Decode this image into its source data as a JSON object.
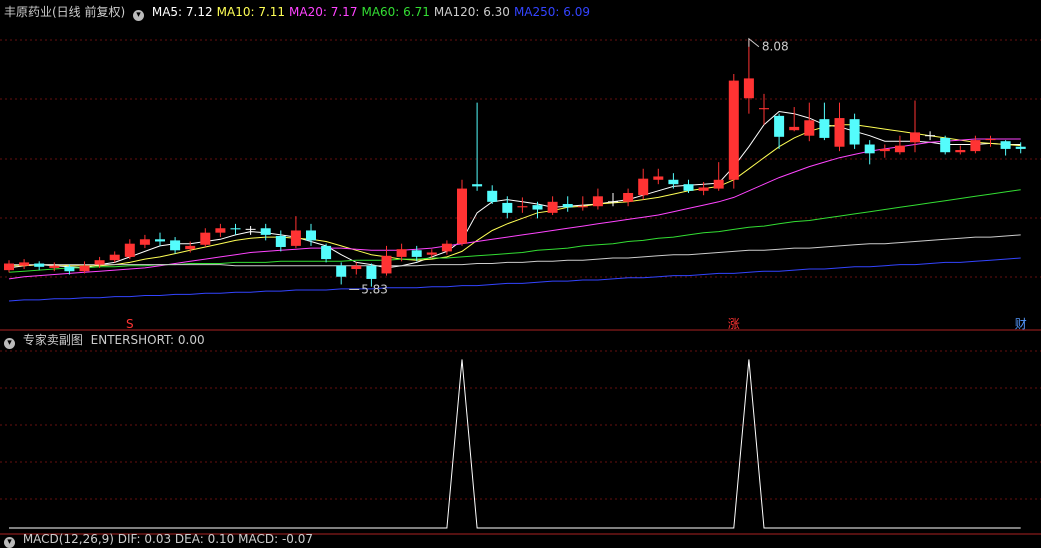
{
  "header": {
    "title": "丰原药业(日线 前复权)",
    "ma": [
      {
        "label": "MA5: 7.12",
        "color": "#ffffff"
      },
      {
        "label": "MA10: 7.11",
        "color": "#ffff55"
      },
      {
        "label": "MA20: 7.17",
        "color": "#ff44ff"
      },
      {
        "label": "MA60: 6.71",
        "color": "#33dd33"
      },
      {
        "label": "MA120: 6.30",
        "color": "#cccccc"
      },
      {
        "label": "MA250: 6.09",
        "color": "#3344ff"
      }
    ]
  },
  "sub_header": {
    "title": "专家卖副图",
    "value": "ENTERSHORT: 0.00"
  },
  "bottom_header": {
    "text": "MACD(12,26,9) DIF: 0.03 DEA: 0.10 MACD: -0.07"
  },
  "markers": [
    {
      "label": "S",
      "index": 8,
      "color": "#ff3333"
    },
    {
      "label": "涨",
      "index": 48,
      "color": "#ff3333"
    },
    {
      "label": "财",
      "index": 67,
      "color": "#5599ff"
    }
  ],
  "colors": {
    "up": "#ff3333",
    "down": "#54fcfc",
    "grid": "#661111",
    "axis": "#aa2222",
    "line": "#ffffff"
  },
  "chart_data": [
    {
      "type": "candlestick",
      "ylim": [
        5.6,
        8.25
      ],
      "max_label": "8.08",
      "min_label": "5.83",
      "max_index": 49,
      "min_index": 22,
      "candles": [
        [
          5.98,
          6.04,
          6.07,
          5.96
        ],
        [
          6.02,
          6.05,
          6.08,
          5.99
        ],
        [
          6.04,
          6.01,
          6.06,
          5.98
        ],
        [
          6.0,
          6.02,
          6.05,
          5.97
        ],
        [
          6.01,
          5.97,
          6.03,
          5.94
        ],
        [
          5.97,
          6.02,
          6.06,
          5.95
        ],
        [
          6.03,
          6.07,
          6.1,
          6.0
        ],
        [
          6.07,
          6.12,
          6.15,
          6.05
        ],
        [
          6.1,
          6.22,
          6.26,
          6.08
        ],
        [
          6.21,
          6.26,
          6.3,
          6.18
        ],
        [
          6.26,
          6.24,
          6.32,
          6.2
        ],
        [
          6.25,
          6.16,
          6.28,
          6.13
        ],
        [
          6.17,
          6.2,
          6.24,
          6.14
        ],
        [
          6.21,
          6.32,
          6.36,
          6.19
        ],
        [
          6.32,
          6.36,
          6.4,
          6.28
        ],
        [
          6.36,
          6.35,
          6.4,
          6.3
        ],
        [
          6.35,
          6.35,
          6.38,
          6.3
        ],
        [
          6.36,
          6.3,
          6.4,
          6.25
        ],
        [
          6.29,
          6.19,
          6.34,
          6.15
        ],
        [
          6.2,
          6.34,
          6.47,
          6.18
        ],
        [
          6.34,
          6.25,
          6.4,
          6.2
        ],
        [
          6.2,
          6.08,
          6.22,
          6.05
        ],
        [
          6.02,
          5.92,
          6.05,
          5.85
        ],
        [
          5.99,
          6.02,
          6.05,
          5.94
        ],
        [
          6.02,
          5.9,
          6.04,
          5.83
        ],
        [
          5.95,
          6.11,
          6.2,
          5.93
        ],
        [
          6.1,
          6.17,
          6.22,
          6.06
        ],
        [
          6.16,
          6.1,
          6.2,
          6.06
        ],
        [
          6.12,
          6.14,
          6.17,
          6.09
        ],
        [
          6.15,
          6.22,
          6.25,
          6.12
        ],
        [
          6.22,
          6.72,
          6.8,
          6.2
        ],
        [
          6.76,
          6.74,
          7.5,
          6.7
        ],
        [
          6.7,
          6.6,
          6.75,
          6.58
        ],
        [
          6.59,
          6.5,
          6.65,
          6.45
        ],
        [
          6.55,
          6.56,
          6.64,
          6.5
        ],
        [
          6.57,
          6.53,
          6.6,
          6.45
        ],
        [
          6.5,
          6.6,
          6.65,
          6.48
        ],
        [
          6.58,
          6.55,
          6.65,
          6.51
        ],
        [
          6.55,
          6.56,
          6.65,
          6.52
        ],
        [
          6.56,
          6.65,
          6.72,
          6.53
        ],
        [
          6.6,
          6.6,
          6.68,
          6.56
        ],
        [
          6.6,
          6.68,
          6.72,
          6.56
        ],
        [
          6.66,
          6.81,
          6.9,
          6.62
        ],
        [
          6.8,
          6.83,
          6.9,
          6.76
        ],
        [
          6.8,
          6.76,
          6.86,
          6.72
        ],
        [
          6.76,
          6.7,
          6.8,
          6.68
        ],
        [
          6.7,
          6.73,
          6.78,
          6.66
        ],
        [
          6.72,
          6.8,
          6.96,
          6.7
        ],
        [
          6.8,
          7.7,
          7.76,
          6.72
        ],
        [
          7.54,
          7.72,
          8.08,
          7.4
        ],
        [
          7.44,
          7.45,
          7.58,
          7.3
        ],
        [
          7.38,
          7.19,
          7.4,
          7.08
        ],
        [
          7.25,
          7.28,
          7.46,
          7.24
        ],
        [
          7.2,
          7.34,
          7.5,
          7.15
        ],
        [
          7.35,
          7.18,
          7.5,
          7.16
        ],
        [
          7.1,
          7.36,
          7.5,
          7.06
        ],
        [
          7.35,
          7.12,
          7.4,
          7.08
        ],
        [
          7.12,
          7.04,
          7.16,
          6.94
        ],
        [
          7.06,
          7.08,
          7.12,
          7.0
        ],
        [
          7.05,
          7.11,
          7.2,
          7.03
        ],
        [
          7.14,
          7.23,
          7.52,
          7.05
        ],
        [
          7.2,
          7.2,
          7.24,
          7.16
        ],
        [
          7.18,
          7.05,
          7.2,
          7.03
        ],
        [
          7.05,
          7.07,
          7.11,
          7.03
        ],
        [
          7.06,
          7.16,
          7.2,
          7.04
        ],
        [
          7.16,
          7.17,
          7.2,
          7.1
        ],
        [
          7.15,
          7.08,
          7.16,
          7.02
        ],
        [
          7.1,
          7.08,
          7.14,
          7.04
        ]
      ],
      "ma_series": [
        {
          "name": "MA5",
          "color": "#ffffff",
          "values": [
            6.0,
            6.02,
            6.03,
            6.02,
            6.01,
            6.0,
            6.03,
            6.05,
            6.1,
            6.15,
            6.2,
            6.22,
            6.22,
            6.24,
            6.26,
            6.3,
            6.33,
            6.32,
            6.3,
            6.28,
            6.24,
            6.2,
            6.12,
            6.05,
            6.03,
            6.0,
            6.02,
            6.05,
            6.1,
            6.15,
            6.25,
            6.5,
            6.6,
            6.62,
            6.6,
            6.58,
            6.55,
            6.56,
            6.57,
            6.58,
            6.6,
            6.62,
            6.66,
            6.7,
            6.74,
            6.75,
            6.76,
            6.77,
            6.92,
            7.1,
            7.3,
            7.42,
            7.4,
            7.36,
            7.3,
            7.28,
            7.24,
            7.2,
            7.15,
            7.15,
            7.15,
            7.14,
            7.12,
            7.12,
            7.12,
            7.13,
            7.12,
            7.12
          ]
        },
        {
          "name": "MA10",
          "color": "#ffff55",
          "values": [
            6.02,
            6.02,
            6.03,
            6.03,
            6.02,
            6.02,
            6.02,
            6.03,
            6.05,
            6.08,
            6.1,
            6.13,
            6.16,
            6.19,
            6.22,
            6.25,
            6.27,
            6.28,
            6.28,
            6.27,
            6.26,
            6.24,
            6.2,
            6.16,
            6.12,
            6.1,
            6.08,
            6.07,
            6.08,
            6.1,
            6.15,
            6.25,
            6.34,
            6.4,
            6.45,
            6.5,
            6.52,
            6.55,
            6.56,
            6.58,
            6.59,
            6.6,
            6.62,
            6.64,
            6.67,
            6.7,
            6.72,
            6.74,
            6.8,
            6.9,
            7.0,
            7.1,
            7.18,
            7.24,
            7.28,
            7.3,
            7.3,
            7.28,
            7.26,
            7.24,
            7.22,
            7.2,
            7.18,
            7.16,
            7.14,
            7.13,
            7.12,
            7.11
          ]
        },
        {
          "name": "MA20",
          "color": "#ff44ff",
          "values": [
            5.9,
            5.92,
            5.93,
            5.94,
            5.95,
            5.96,
            5.97,
            5.98,
            5.99,
            6.0,
            6.02,
            6.04,
            6.06,
            6.08,
            6.1,
            6.12,
            6.14,
            6.15,
            6.16,
            6.17,
            6.18,
            6.18,
            6.18,
            6.17,
            6.16,
            6.16,
            6.16,
            6.17,
            6.18,
            6.2,
            6.22,
            6.24,
            6.26,
            6.28,
            6.3,
            6.32,
            6.34,
            6.36,
            6.38,
            6.4,
            6.42,
            6.44,
            6.46,
            6.48,
            6.51,
            6.54,
            6.57,
            6.6,
            6.64,
            6.7,
            6.76,
            6.82,
            6.87,
            6.92,
            6.96,
            7.0,
            7.03,
            7.06,
            7.08,
            7.1,
            7.12,
            7.14,
            7.15,
            7.16,
            7.17,
            7.17,
            7.17,
            7.17
          ]
        },
        {
          "name": "MA60",
          "color": "#33dd33",
          "values": [
            5.96,
            5.97,
            5.98,
            5.99,
            6.0,
            6.0,
            6.01,
            6.01,
            6.02,
            6.02,
            6.03,
            6.03,
            6.04,
            6.04,
            6.04,
            6.05,
            6.05,
            6.05,
            6.06,
            6.06,
            6.06,
            6.06,
            6.06,
            6.07,
            6.07,
            6.07,
            6.08,
            6.08,
            6.09,
            6.09,
            6.1,
            6.11,
            6.12,
            6.13,
            6.14,
            6.16,
            6.17,
            6.18,
            6.2,
            6.21,
            6.22,
            6.24,
            6.25,
            6.27,
            6.28,
            6.3,
            6.32,
            6.33,
            6.35,
            6.37,
            6.38,
            6.4,
            6.42,
            6.43,
            6.45,
            6.47,
            6.49,
            6.51,
            6.53,
            6.55,
            6.57,
            6.59,
            6.61,
            6.63,
            6.65,
            6.67,
            6.69,
            6.71
          ]
        },
        {
          "name": "MA120",
          "color": "#cccccc",
          "values": [
            6.03,
            6.03,
            6.03,
            6.03,
            6.03,
            6.03,
            6.03,
            6.03,
            6.03,
            6.03,
            6.03,
            6.03,
            6.03,
            6.03,
            6.03,
            6.02,
            6.02,
            6.02,
            6.02,
            6.02,
            6.02,
            6.02,
            6.02,
            6.02,
            6.02,
            6.02,
            6.02,
            6.02,
            6.03,
            6.03,
            6.03,
            6.04,
            6.04,
            6.05,
            6.05,
            6.06,
            6.06,
            6.07,
            6.07,
            6.08,
            6.09,
            6.09,
            6.1,
            6.11,
            6.12,
            6.12,
            6.13,
            6.14,
            6.15,
            6.16,
            6.16,
            6.17,
            6.18,
            6.18,
            6.19,
            6.2,
            6.21,
            6.22,
            6.22,
            6.23,
            6.24,
            6.25,
            6.26,
            6.27,
            6.28,
            6.28,
            6.29,
            6.3
          ]
        },
        {
          "name": "MA250",
          "color": "#3344ff",
          "values": [
            5.7,
            5.71,
            5.71,
            5.72,
            5.72,
            5.73,
            5.73,
            5.74,
            5.74,
            5.75,
            5.75,
            5.76,
            5.76,
            5.77,
            5.77,
            5.78,
            5.78,
            5.79,
            5.79,
            5.8,
            5.8,
            5.8,
            5.81,
            5.81,
            5.81,
            5.82,
            5.82,
            5.82,
            5.83,
            5.83,
            5.84,
            5.84,
            5.85,
            5.86,
            5.86,
            5.87,
            5.88,
            5.88,
            5.89,
            5.89,
            5.9,
            5.91,
            5.91,
            5.92,
            5.93,
            5.93,
            5.94,
            5.95,
            5.95,
            5.96,
            5.97,
            5.97,
            5.98,
            5.99,
            5.99,
            6.0,
            6.01,
            6.01,
            6.02,
            6.03,
            6.03,
            6.04,
            6.05,
            6.05,
            6.06,
            6.07,
            6.08,
            6.09
          ]
        }
      ]
    },
    {
      "type": "line",
      "name": "ENTERSHORT",
      "ylim": [
        0,
        1.05
      ],
      "spikes_at": [
        30,
        49
      ],
      "values_note_points": 68
    }
  ]
}
